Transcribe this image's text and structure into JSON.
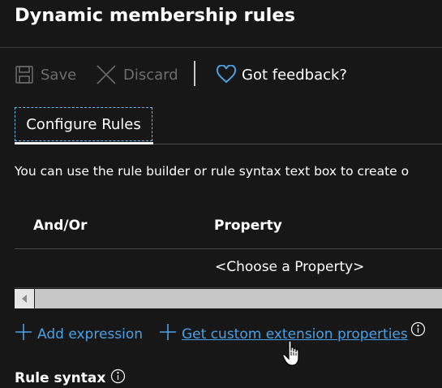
{
  "page": {
    "title": "Dynamic membership rules"
  },
  "toolbar": {
    "save_label": "Save",
    "discard_label": "Discard",
    "feedback_label": "Got feedback?"
  },
  "tabs": [
    {
      "label": "Configure Rules",
      "selected": true
    }
  ],
  "description": "You can use the rule builder or rule syntax text box to create o",
  "rules_table": {
    "columns": [
      "And/Or",
      "Property"
    ],
    "rows": [
      {
        "and_or": "",
        "property": "<Choose a Property>"
      }
    ]
  },
  "actions": {
    "add_expression": "Add expression",
    "get_custom_extension_properties": "Get custom extension properties"
  },
  "rule_syntax": {
    "heading": "Rule syntax"
  },
  "colors": {
    "background": "#171717",
    "link": "#4aa0e6",
    "accent": "#6ab7e8",
    "disabled": "#6d6d6d"
  },
  "icons": [
    "save-icon",
    "discard-icon",
    "heart-icon",
    "plus-icon",
    "info-icon",
    "scroll-left-icon",
    "hand-cursor"
  ]
}
